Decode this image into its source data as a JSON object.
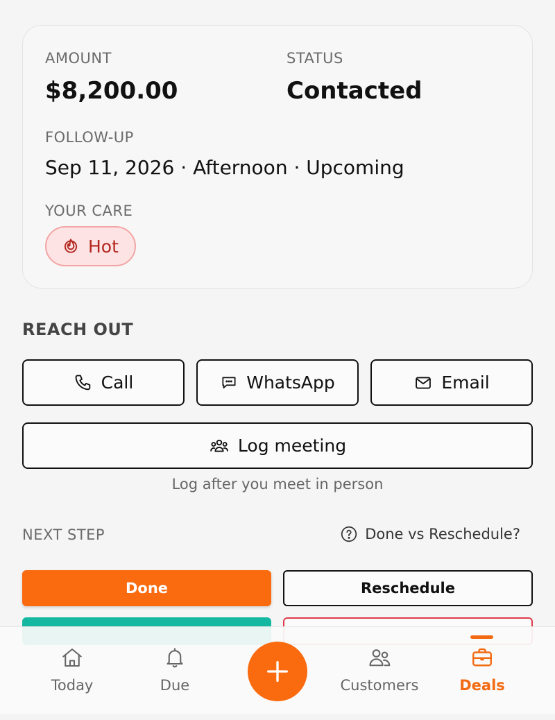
{
  "deal": {
    "amount_label": "AMOUNT",
    "amount_value": "$8,200.00",
    "status_label": "STATUS",
    "status_value": "Contacted",
    "followup_label": "FOLLOW-UP",
    "followup_value": "Sep 11, 2026 · Afternoon · Upcoming",
    "care_label": "YOUR CARE",
    "care_value": "Hot"
  },
  "reach_out": {
    "heading": "REACH OUT",
    "call": "Call",
    "whatsapp": "WhatsApp",
    "email": "Email",
    "log_meeting": "Log meeting",
    "hint": "Log after you meet in person"
  },
  "next_step": {
    "label": "NEXT STEP",
    "help": "Done vs Reschedule?",
    "done": "Done",
    "reschedule": "Reschedule"
  },
  "nav": {
    "today": "Today",
    "due": "Due",
    "customers": "Customers",
    "deals": "Deals"
  },
  "colors": {
    "accent": "#fa6a0f",
    "hot_bg": "#fde3e3",
    "hot_text": "#b3261e",
    "teal": "#14b8a0",
    "danger": "#dd3b4a"
  }
}
